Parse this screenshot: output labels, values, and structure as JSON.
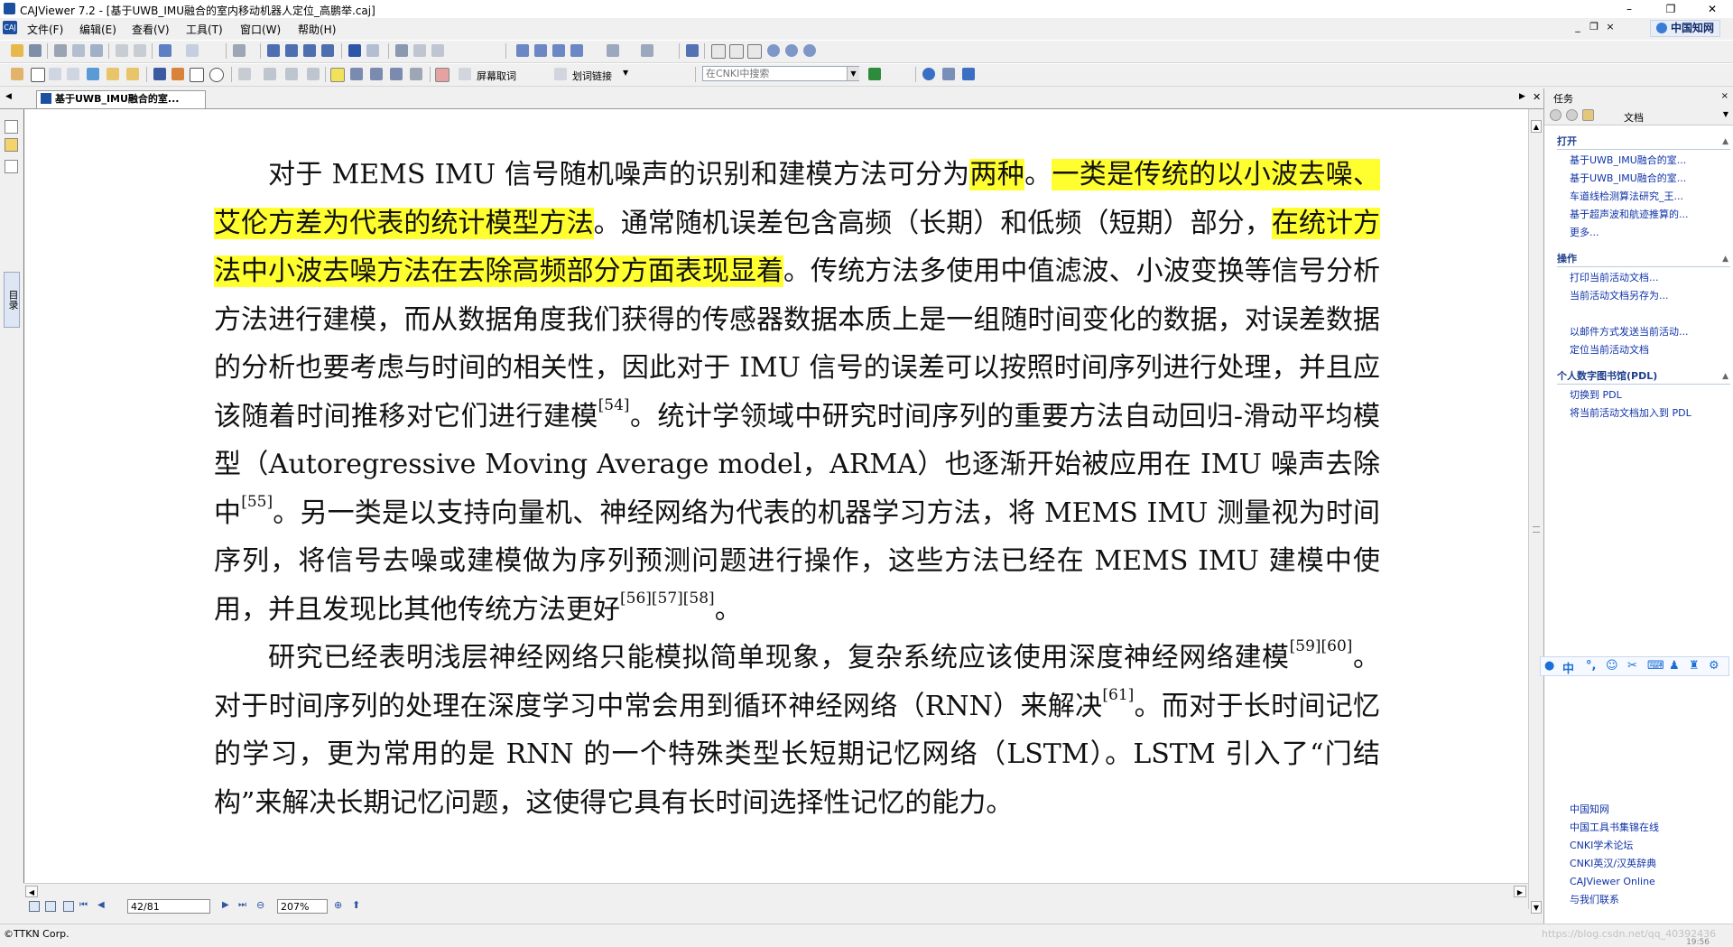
{
  "window": {
    "title": "CAJViewer 7.2 - [基于UWB_IMU融合的室内移动机器人定位_高鹏举.caj]",
    "minimize": "–",
    "restore": "❐",
    "close": "✕"
  },
  "menubar": {
    "items": [
      "文件(F)",
      "编辑(E)",
      "查看(V)",
      "工具(T)",
      "窗口(W)",
      "帮助(H)"
    ],
    "brand": "中国知网",
    "mdi_controls": [
      "_",
      "❐",
      "×"
    ]
  },
  "toolbar2": {
    "screen_capture_label": "屏幕取词",
    "word_link_label": "划词链接",
    "search_placeholder": "在CNKI中搜索"
  },
  "tabs": [
    {
      "label": "基于UWB_IMU融合的室..."
    }
  ],
  "left_strip": {
    "catalog_label": "目录"
  },
  "document": {
    "paragraphs": [
      [
        {
          "t": "对于 MEMS IMU 信号随机噪声的识别和建模方法可分为"
        },
        {
          "t": "两种",
          "hl": true
        },
        {
          "t": "。"
        },
        {
          "t": "一类是传统的以小波去噪、艾伦方差为代表的统计模型方法",
          "hl": true
        },
        {
          "t": "。通常随机误差包含高频（长期）和低频（短期）部分，"
        },
        {
          "t": "在统计方法中小波去噪方法在去除高频部分方面表现显着",
          "hl": true
        },
        {
          "t": "。传统方法多使用中值滤波、小波变换等信号分析方法进行建模，而从数据角度我们获得的传感器数据本质上是一组随时间变化的数据，对误差数据的分析也要考虑与时间的相关性，因此对于 IMU 信号的误差可以按照时间序列进行处理，并且应该随着时间推移对它们进行建模"
        },
        {
          "t": "[54]",
          "sup": true
        },
        {
          "t": "。统计学领域中研究时间序列的重要方法自动回归-滑动平均模型（Autoregressive Moving Average model，ARMA）也逐渐开始被应用在 IMU 噪声去除中"
        },
        {
          "t": "[55]",
          "sup": true
        },
        {
          "t": "。另一类是以支持向量机、神经网络为代表的机器学习方法，将 MEMS IMU 测量视为时间序列，将信号去噪或建模做为序列预测问题进行操作，这些方法已经在 MEMS IMU 建模中使用，并且发现比其他传统方法更好"
        },
        {
          "t": "[56][57][58]",
          "sup": true
        },
        {
          "t": "。"
        }
      ],
      [
        {
          "t": "研究已经表明浅层神经网络只能模拟简单现象，复杂系统应该使用深度神经网络建模"
        },
        {
          "t": "[59][60]",
          "sup": true
        },
        {
          "t": "。对于时间序列的处理在深度学习中常会用到循环神经网络（RNN）来解决"
        },
        {
          "t": "[61]",
          "sup": true
        },
        {
          "t": "。而对于长时间记忆的学习，更为常用的是 RNN 的一个特殊类型长短期记忆网络（LSTM）。LSTM 引入了“门结构”来解决长期记忆问题，这使得它具有长时间选择性记忆的能力。"
        }
      ]
    ],
    "highlight_color": "#ffff30"
  },
  "navbar": {
    "page_value": "42/81",
    "zoom_value": "207%"
  },
  "statusbar": {
    "text": "©TTKN Corp.",
    "watermark": "https://blog.csdn.net/qq_40392436",
    "clock": "19:56"
  },
  "taskpane": {
    "title": "任务",
    "nav_label": "文档",
    "sections": {
      "open": {
        "title": "打开",
        "items": [
          "基于UWB_IMU融合的室...",
          "基于UWB_IMU融合的室...",
          "车道线检测算法研究_王...",
          "基于超声波和航迹推算的...",
          "更多..."
        ]
      },
      "ops": {
        "title": "操作",
        "items": [
          "打印当前活动文档...",
          "当前活动文档另存为...",
          "以邮件方式发送当前活动...",
          "定位当前活动文档"
        ]
      },
      "pdl": {
        "title": "个人数字图书馆(PDL)",
        "items": [
          "切换到 PDL",
          "将当前活动文档加入到 PDL"
        ]
      },
      "links": {
        "items": [
          "中国知网",
          "中国工具书集锦在线",
          "CNKI学术论坛",
          "CNKI英汉/汉英辞典",
          "CAJViewer Online",
          "与我们联系"
        ]
      }
    },
    "ime": {
      "items": [
        "中",
        "°,",
        "☺",
        "⌨"
      ]
    }
  }
}
